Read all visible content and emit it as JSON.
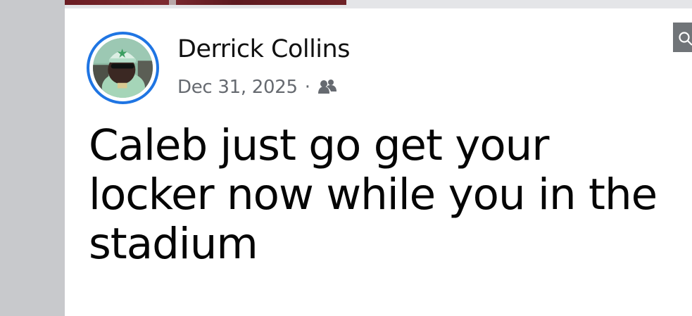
{
  "post": {
    "author_name": "Derrick Collins",
    "date": "Dec 31, 2025",
    "separator": "·",
    "audience_icon": "friends-icon",
    "text": "Caleb just go get your locker now while you in the stadium"
  },
  "colors": {
    "avatar_ring": "#1f75e3",
    "meta_text": "#666a70",
    "post_text": "#050505"
  },
  "top_right_control": {
    "icon": "search-icon"
  }
}
